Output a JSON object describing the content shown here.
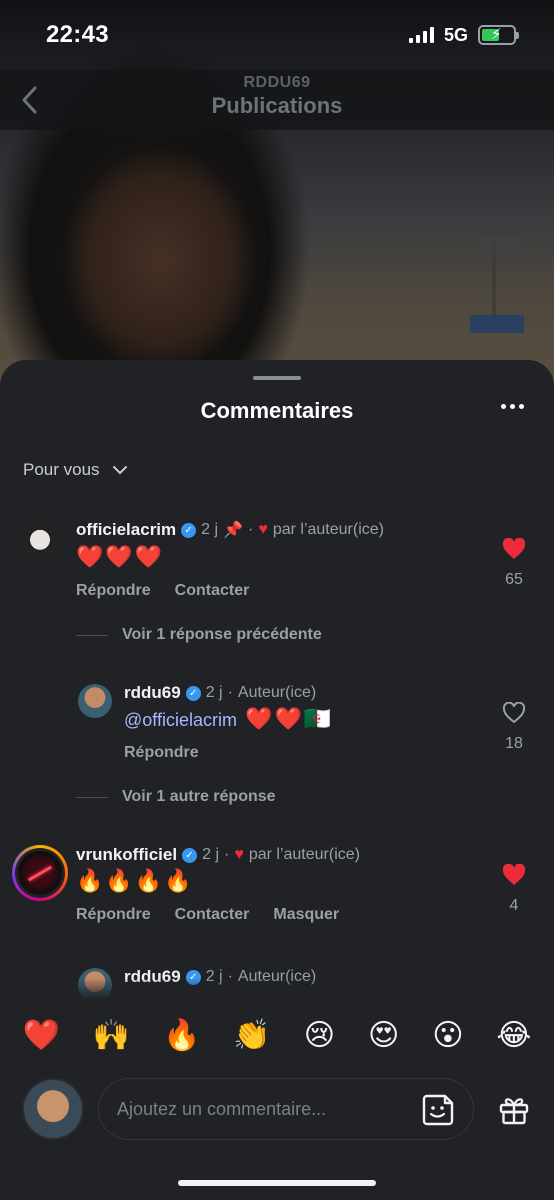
{
  "status_bar": {
    "time": "22:43",
    "network": "5G"
  },
  "header": {
    "account": "RDDU69",
    "title": "Publications"
  },
  "sheet": {
    "title": "Commentaires",
    "filter_label": "Pour vous"
  },
  "comments": [
    {
      "username": "officielacrim",
      "age": "2 j",
      "liked_by_author": "par l’auteur(ice)",
      "text": "❤️❤️❤️",
      "actions": [
        "Répondre",
        "Contacter"
      ],
      "likes": "65",
      "view_replies": "Voir 1 réponse précédente"
    },
    {
      "username": "rddu69",
      "age": "2 j",
      "role": "Auteur(ice)",
      "mention": "@officielacrim",
      "text": "❤️❤️🇩🇿",
      "actions": [
        "Répondre"
      ],
      "likes": "18",
      "view_replies": "Voir 1 autre réponse"
    },
    {
      "username": "vrunkofficiel",
      "age": "2 j",
      "liked_by_author": "par l’auteur(ice)",
      "text": "🔥🔥🔥🔥",
      "actions": [
        "Répondre",
        "Contacter",
        "Masquer"
      ],
      "likes": "4"
    },
    {
      "username": "rddu69",
      "age": "2 j",
      "role": "Auteur(ice)"
    }
  ],
  "reactions": [
    "❤️",
    "🙌",
    "🔥",
    "👏",
    "😢",
    "😍",
    "😮",
    "😂"
  ],
  "composer": {
    "placeholder": "Ajoutez un commentaire..."
  },
  "colors": {
    "like_red": "#ed2b3b",
    "verified_blue": "#3897f0",
    "mention": "#a6b8ff"
  }
}
